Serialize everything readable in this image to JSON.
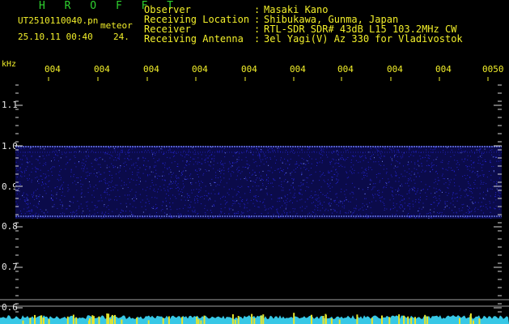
{
  "header": {
    "title": "H R O F F T",
    "file_name": "UT2510110040.pn",
    "mode": "meteor",
    "date_time": "25.10.11 00:40",
    "count": "24."
  },
  "info": [
    {
      "key": "Observer",
      "value": "Masaki Kano"
    },
    {
      "key": "Receiving Location",
      "value": "Shibukawa, Gunma, Japan"
    },
    {
      "key": "Receiver",
      "value": "RTL-SDR SDR# 43dB L15 103.2MHz CW"
    },
    {
      "key": "Receiving Antenna",
      "value": "3el Yagi(V) Az 330 for Vladivostok"
    }
  ],
  "info_separator": ":",
  "axis": {
    "unit": "kHz",
    "time_labels": [
      "004",
      "004",
      "004",
      "004",
      "004",
      "004",
      "004",
      "004",
      "004",
      "0050"
    ],
    "freq_labels": [
      "1.1",
      "1.0",
      "0.9",
      "0.8",
      "0.7",
      "0.6"
    ]
  },
  "colors": {
    "background": "#000000",
    "text_yellow": "#f2ef2a",
    "title_green": "#2fd12f",
    "band_dark": "#0b0b4a",
    "band_mid": "#2222c8",
    "band_bright": "#7a8cff",
    "ticks": "#d8d8d8",
    "spectrum_cyan": "#37c8e6",
    "spectrum_yellow": "#e7e52c"
  }
}
